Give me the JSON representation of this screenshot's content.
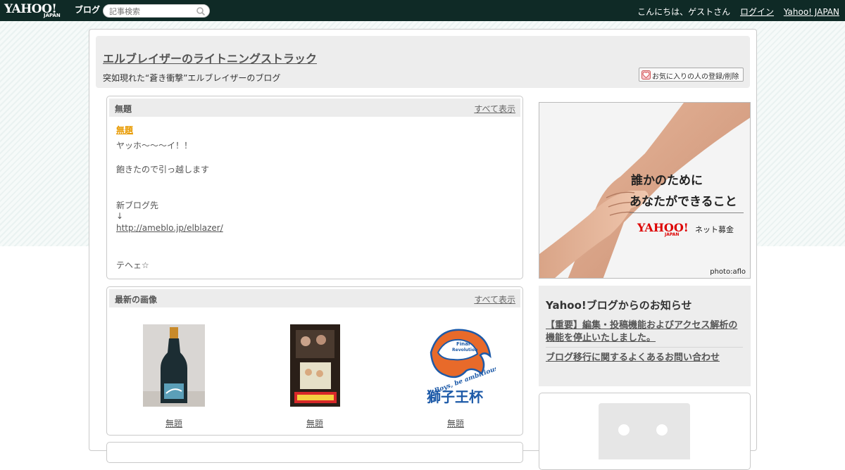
{
  "topbar": {
    "logo": "YAHOO!",
    "logo_sub": "JAPAN",
    "logo_blog": "ブログ",
    "search_placeholder": "記事検索",
    "greeting": "こんにちは、ゲストさん",
    "login": "ログイン",
    "yahoo_japan": "Yahoo! JAPAN"
  },
  "header": {
    "title": "エルブレイザーのライトニングストラック",
    "description": "突如現れた“蒼き衝撃”エルブレイザーのブログ",
    "favorite_button": "お気に入りの人の登録/削除"
  },
  "post_panel": {
    "heading": "無題",
    "show_all": "すべて表示",
    "post_title": "無題",
    "lines": [
      "ヤッホ～～～イ！！",
      "飽きたので引っ越します",
      "新ブログ先",
      "↓",
      "http://ameblo.jp/elblazer/",
      "テヘェ☆"
    ]
  },
  "images_panel": {
    "heading": "最新の画像",
    "show_all": "すべて表示",
    "images": [
      {
        "caption": "無題"
      },
      {
        "caption": "無題"
      },
      {
        "caption": "無題"
      }
    ],
    "image3_texts": [
      "Final",
      "Revolution",
      "Boys, be ambitious!",
      "獅子王杯"
    ]
  },
  "ad": {
    "line1": "誰かのために",
    "line2": "あなたができること",
    "brand": "YAHOO!",
    "brand_japan": "JAPAN",
    "brand_service": "ネット募金",
    "credit": "photo:aflo"
  },
  "notice": {
    "title": "Yahoo!ブログからのお知らせ",
    "items": [
      "【重要】編集・投稿機能およびアクセス解析の機能を停止いたしました。",
      "ブログ移行に関するよくあるお問い合わせ"
    ]
  },
  "colors": {
    "topbar": "#0f2a26",
    "post_title": "#e89a00",
    "ad_brand": "#dd0000"
  }
}
